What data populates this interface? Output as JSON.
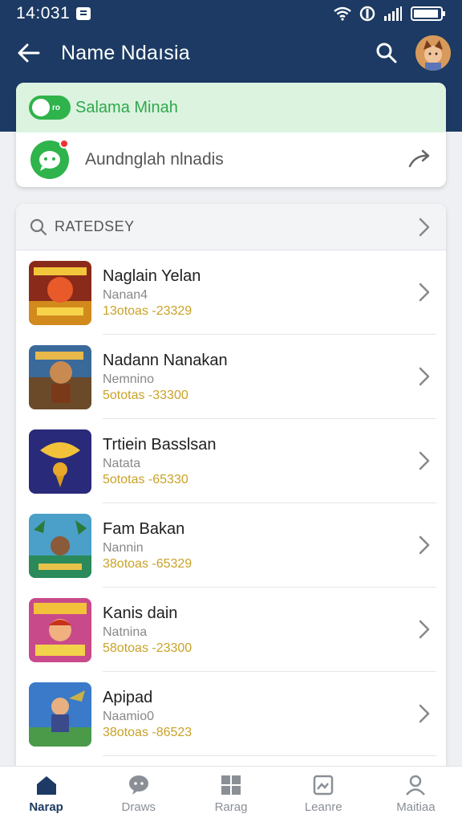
{
  "status_bar": {
    "time": "14:031"
  },
  "app_bar": {
    "title": "Name Ndaısia"
  },
  "top_card": {
    "green_pill_text": "ro",
    "green_label": "Salama Minah",
    "row_label": "Aundnglah nlnadis"
  },
  "list": {
    "header": "RATEDSEY",
    "items": [
      {
        "name": "Naglain Yelan",
        "sub": "Nanan4",
        "meta": "13otoas -23329"
      },
      {
        "name": "Nadann Nanakan",
        "sub": "Nemnino",
        "meta": "5ototas -33300"
      },
      {
        "name": "Trtiein Basslsan",
        "sub": "Natata",
        "meta": "5ototas -65330"
      },
      {
        "name": "Fam Bakan",
        "sub": "Nannin",
        "meta": "38otoas -65329"
      },
      {
        "name": "Kanis dain",
        "sub": "Natnina",
        "meta": "58otoas -23300"
      },
      {
        "name": "Apipad",
        "sub": "Naamio0",
        "meta": "38otoas -86523"
      }
    ]
  },
  "bottom_nav": [
    {
      "label": "Narap"
    },
    {
      "label": "Draws"
    },
    {
      "label": "Rarag"
    },
    {
      "label": "Leanre"
    },
    {
      "label": "Maitiaa"
    }
  ],
  "colors": {
    "primary": "#1c3a63",
    "green": "#2fb34b",
    "gold": "#c9a227"
  }
}
